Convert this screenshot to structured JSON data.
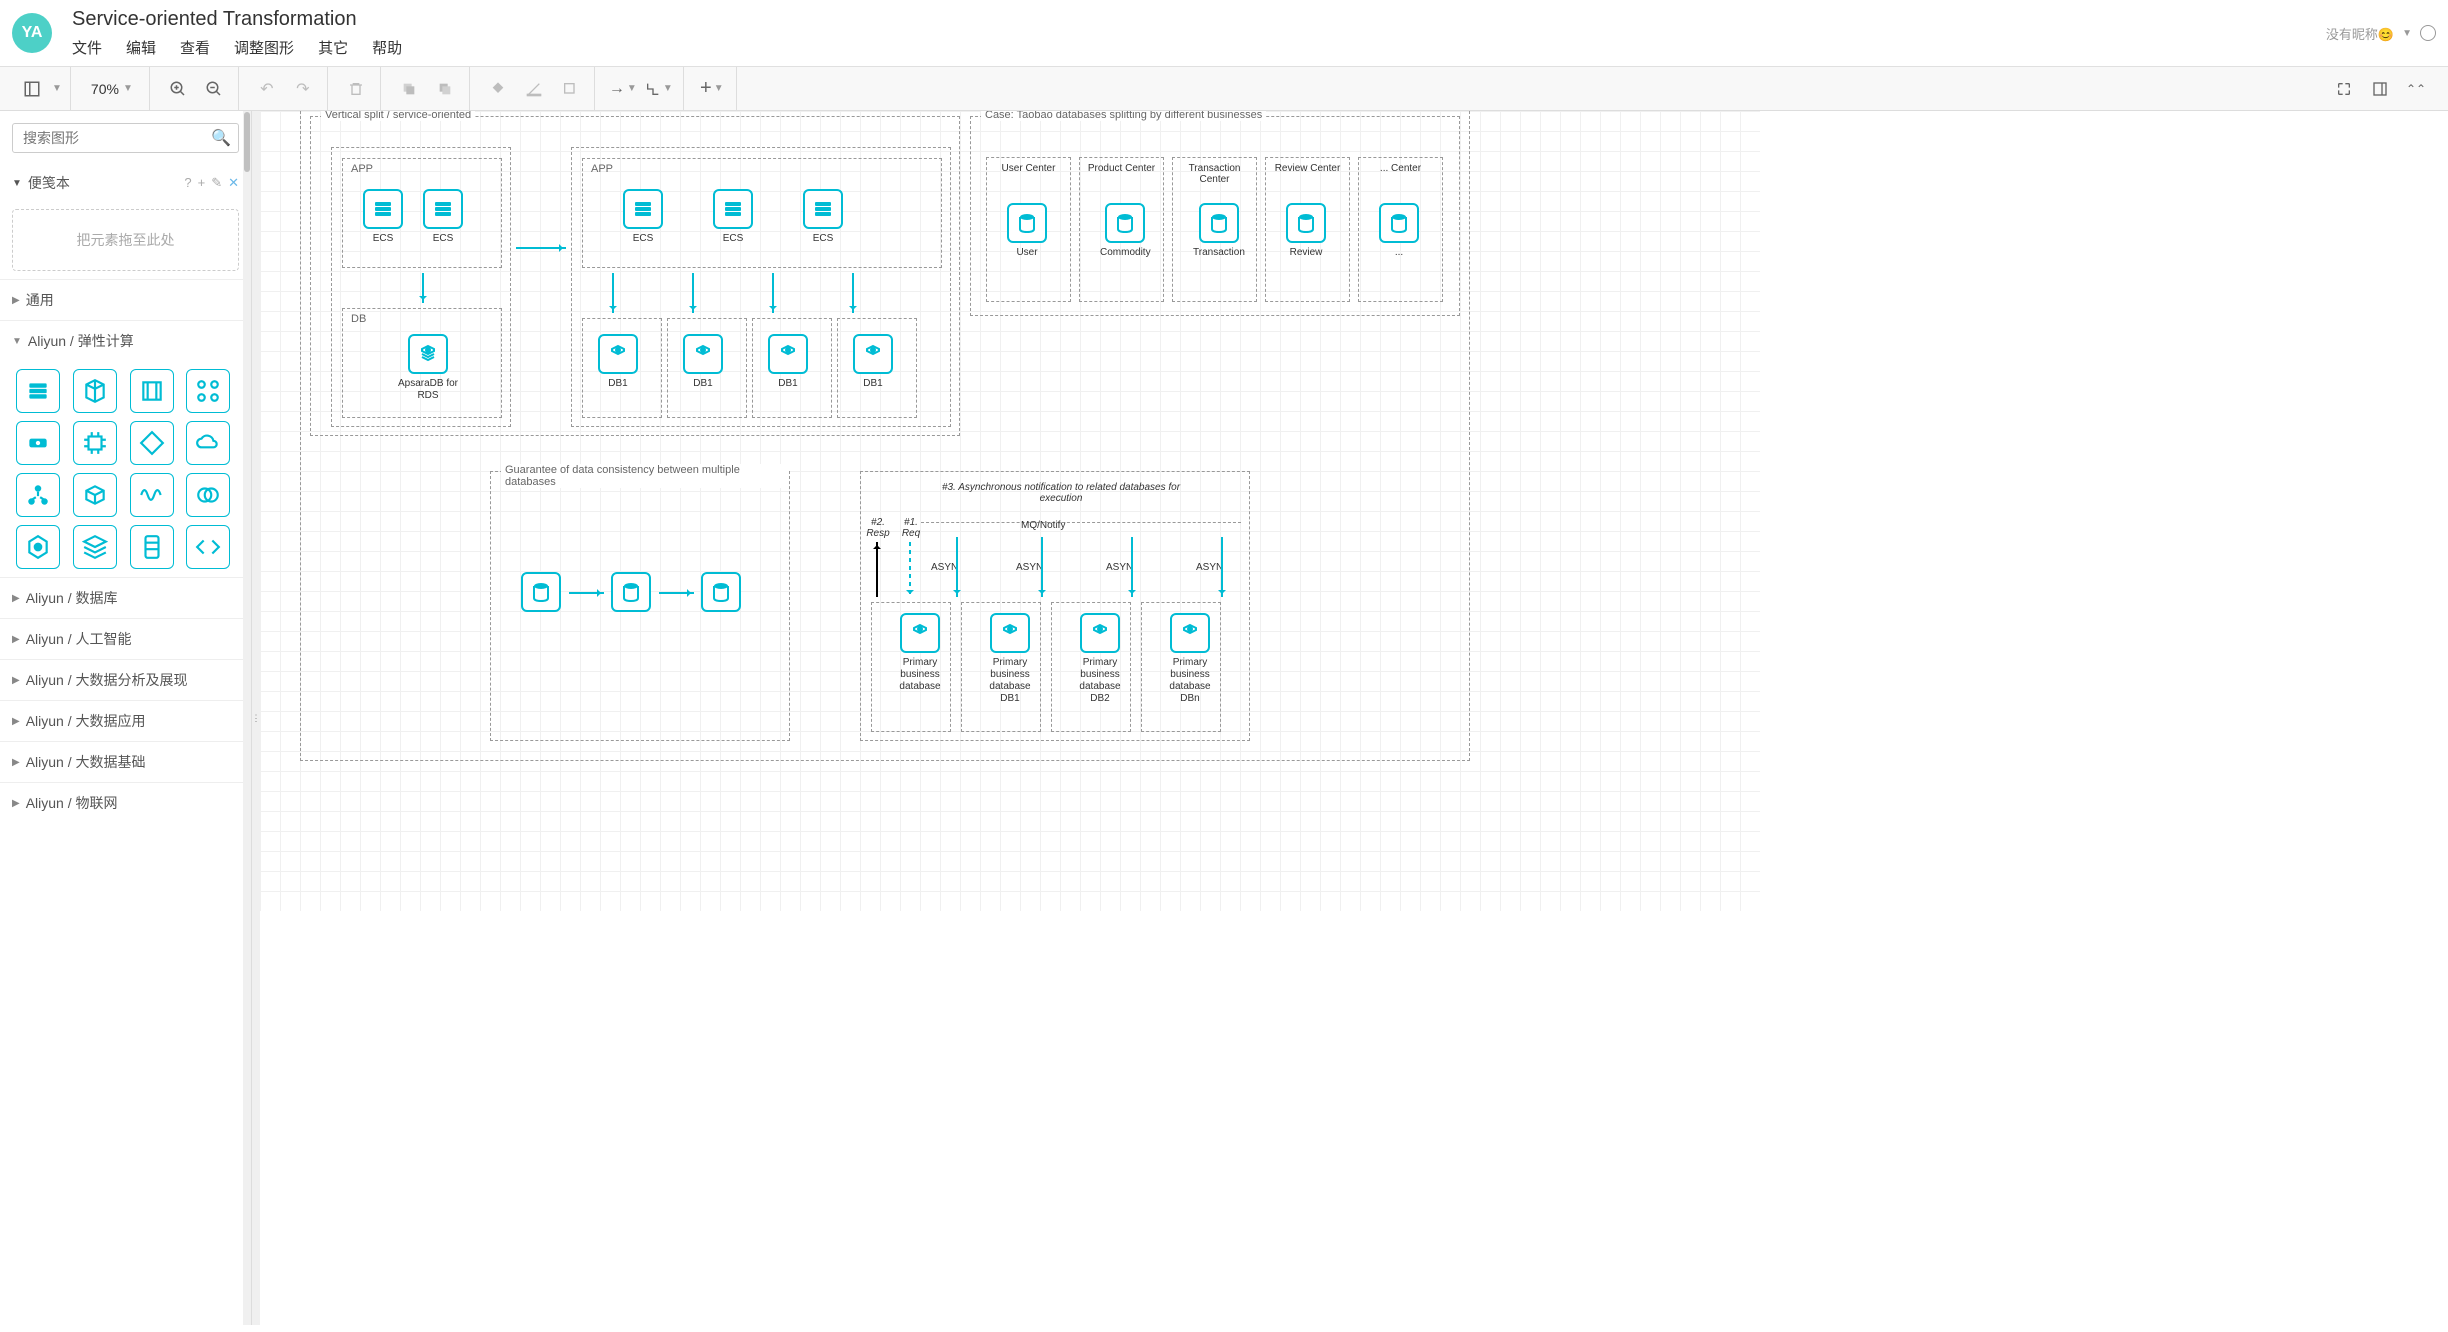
{
  "header": {
    "avatar": "YA",
    "title": "Service-oriented Transformation",
    "menu": [
      "文件",
      "编辑",
      "查看",
      "调整图形",
      "其它",
      "帮助"
    ],
    "user_label": "没有昵称😊",
    "user_arrow": "▼"
  },
  "toolbar": {
    "zoom": "70%"
  },
  "sidebar": {
    "search_placeholder": "搜索图形",
    "scratchpad": {
      "title": "便笺本",
      "help": "?",
      "drop_hint": "把元素拖至此处"
    },
    "categories": [
      {
        "title": "通用",
        "expanded": false
      },
      {
        "title": "Aliyun / 弹性计算",
        "expanded": true
      },
      {
        "title": "Aliyun / 数据库",
        "expanded": false
      },
      {
        "title": "Aliyun / 人工智能",
        "expanded": false
      },
      {
        "title": "Aliyun / 大数据分析及展现",
        "expanded": false
      },
      {
        "title": "Aliyun / 大数据应用",
        "expanded": false
      },
      {
        "title": "Aliyun / 大数据基础",
        "expanded": false
      },
      {
        "title": "Aliyun / 物联网",
        "expanded": false
      }
    ]
  },
  "diagram": {
    "section1_title": "Vertical split / service-oriented",
    "section2_title": "Case: Taobao databases splitting by different businesses",
    "section3_title": "Guarantee of data consistency between multiple databases",
    "app_label": "APP",
    "db_label": "DB",
    "ecs": "ECS",
    "rds": "ApsaraDB for RDS",
    "db1": "DB1",
    "centers": [
      {
        "header": "User Center",
        "db": "User"
      },
      {
        "header": "Product Center",
        "db": "Commodity"
      },
      {
        "header": "Transaction Center",
        "db": "Transaction"
      },
      {
        "header": "Review Center",
        "db": "Review"
      },
      {
        "header": "... Center",
        "db": "..."
      }
    ],
    "async_note": "#3. Asynchronous notification to related databases for execution",
    "mq_notify": "MQ/Notify",
    "resp": "#2. Resp",
    "req": "#1. Req",
    "asyn": "ASYN",
    "primary_dbs": [
      "Primary business database",
      "Primary business database DB1",
      "Primary business database DB2",
      "Primary business database DBn"
    ]
  }
}
